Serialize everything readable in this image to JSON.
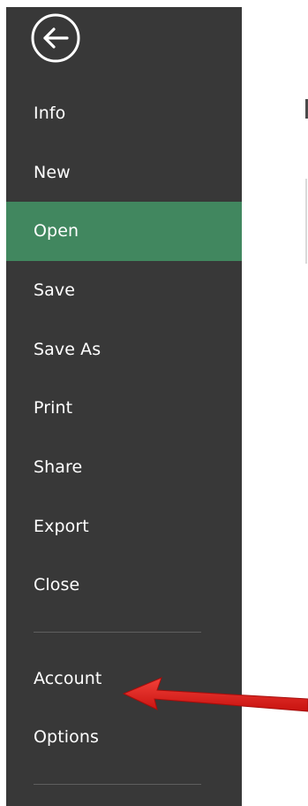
{
  "backstage": {
    "back_icon": "back-arrow-icon",
    "items": [
      {
        "label": "Info",
        "active": false
      },
      {
        "label": "New",
        "active": false
      },
      {
        "label": "Open",
        "active": true
      },
      {
        "label": "Save",
        "active": false
      },
      {
        "label": "Save As",
        "active": false
      },
      {
        "label": "Print",
        "active": false
      },
      {
        "label": "Share",
        "active": false
      },
      {
        "label": "Export",
        "active": false
      },
      {
        "label": "Close",
        "active": false
      }
    ],
    "footer_items": [
      {
        "label": "Account",
        "active": false
      },
      {
        "label": "Options",
        "active": false
      }
    ]
  },
  "colors": {
    "sidebar_bg": "#383838",
    "active_bg": "#41875f",
    "text": "#ffffff",
    "annotation_arrow": "#e8201e"
  }
}
